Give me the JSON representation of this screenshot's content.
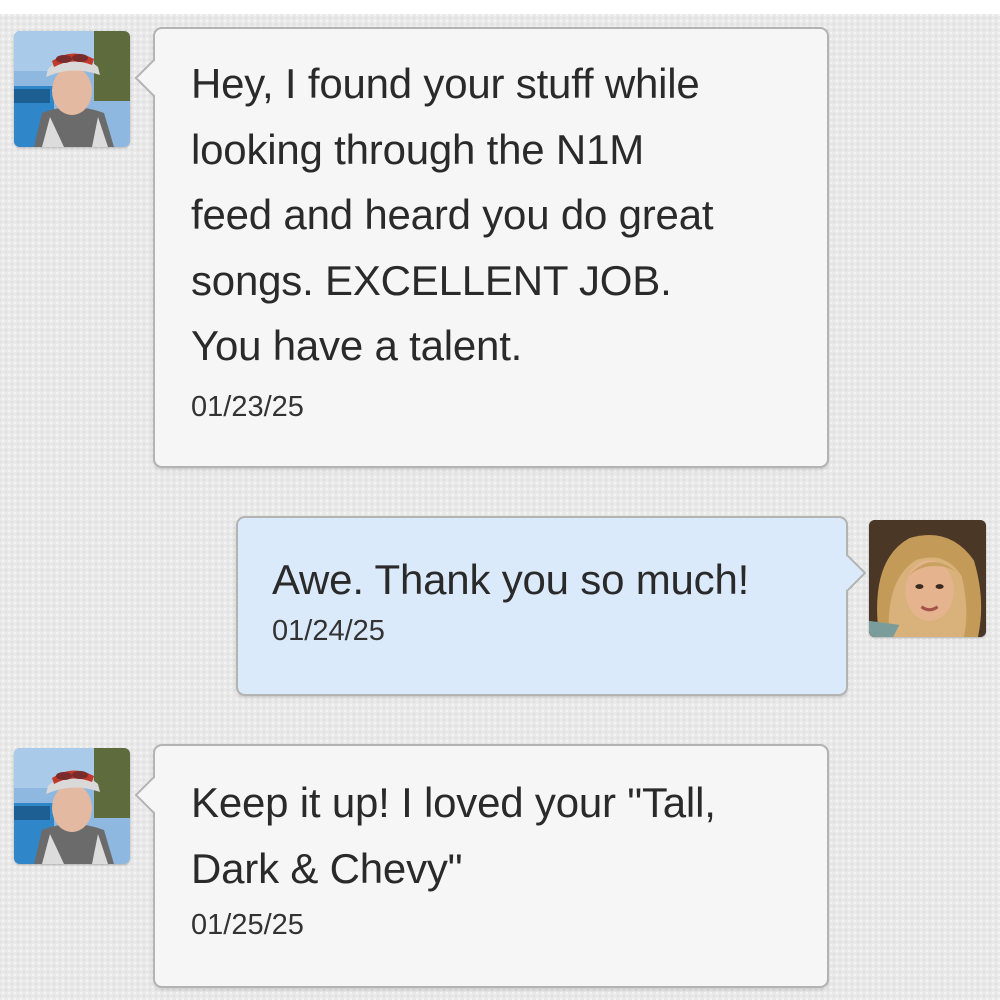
{
  "messages": [
    {
      "direction": "incoming",
      "sender_avatar": "avatar-young-man-cap",
      "text": "Hey, I found your stuff while\nlooking through the N1M\nfeed and heard you do great\nsongs. EXCELLENT JOB.\nYou have a talent.",
      "date": "01/23/25"
    },
    {
      "direction": "outgoing",
      "sender_avatar": "avatar-woman-blonde",
      "text": "Awe. Thank you so much!",
      "date": "01/24/25"
    },
    {
      "direction": "incoming",
      "sender_avatar": "avatar-young-man-cap",
      "text": "Keep it up! I loved your \"Tall,\nDark & Chevy\"",
      "date": "01/25/25"
    }
  ],
  "colors": {
    "incoming_bubble": "#f6f6f6",
    "outgoing_bubble": "#dbeafb",
    "bubble_border": "#b3b3b3",
    "text": "#2a2a2a",
    "background": "#e9e9e9"
  }
}
